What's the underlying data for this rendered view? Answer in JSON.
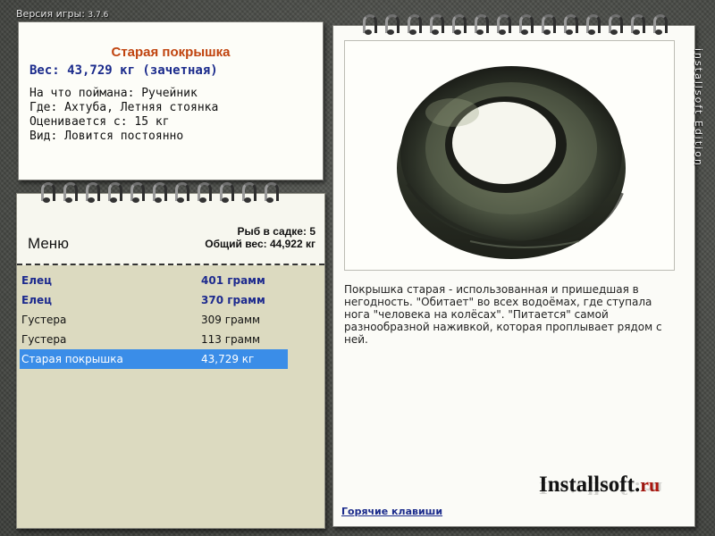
{
  "header": {
    "version_label": "Версия игры:",
    "version_number": "3.7.6"
  },
  "catch_card": {
    "title": "Старая покрышка",
    "weight": "Вес: 43,729 кг (зачетная)",
    "lines": [
      "На что поймана: Ручейник",
      "Где: Ахтуба, Летняя стоянка",
      "Оценивается с: 15 кг",
      "Вид: Ловится постоянно"
    ]
  },
  "menu": {
    "title": "Меню",
    "fish_count": "Рыб в садке: 5",
    "total_weight": "Общий вес: 44,922 кг",
    "items": [
      {
        "name": "Елец",
        "weight": "401 грамм",
        "style": "bold"
      },
      {
        "name": "Елец",
        "weight": "370 грамм",
        "style": "bold"
      },
      {
        "name": "Густера",
        "weight": "309 грамм",
        "style": "normal"
      },
      {
        "name": "Густера",
        "weight": "113 грамм",
        "style": "normal"
      },
      {
        "name": "Старая покрышка",
        "weight": "43,729 кг",
        "style": "selected"
      }
    ]
  },
  "detail": {
    "description": "Покрышка старая - использованная и пришедшая в негодность. \"Обитает\" во всех водоёмах, где ступала нога \"человека на колёсах\". \"Питается\" самой разнообразной наживкой, которая проплывает рядом с ней.",
    "hotkeys_link": "Горячие клавиши"
  },
  "branding": {
    "logo_main": "Installsoft.",
    "logo_suffix": "ru",
    "vertical_text": "installsoft Edition"
  },
  "colors": {
    "title": "#c0430e",
    "weight": "#1b2b8c",
    "selected_row": "#3a8de8"
  }
}
